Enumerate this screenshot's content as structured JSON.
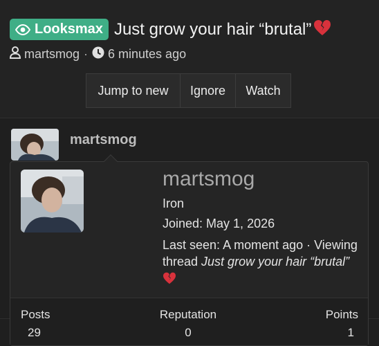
{
  "thread": {
    "prefix": "Looksmax",
    "title": "Just grow your hair “brutal”",
    "author": "martsmog",
    "separator": "·",
    "time": "6 minutes ago"
  },
  "actions": {
    "jump_label": "Jump to new",
    "ignore_label": "Ignore",
    "watch_label": "Watch"
  },
  "post": {
    "username": "martsmog"
  },
  "tooltip": {
    "username": "martsmog",
    "rank": "Iron",
    "joined": "Joined: May 1, 2026",
    "last_seen_prefix": "Last seen: A moment ago · Viewing thread ",
    "viewing_title": "Just grow your hair “brutal”",
    "stats": [
      {
        "label": "Posts",
        "value": "29"
      },
      {
        "label": "Reputation",
        "value": "0"
      },
      {
        "label": "Points",
        "value": "1"
      }
    ]
  },
  "colors": {
    "prefix_bg": "#3fae86",
    "background": "#232323",
    "tooltip_bg": "#252525"
  },
  "icons": {
    "prefix": "eye-icon",
    "author": "user-icon",
    "time": "clock-icon",
    "title_emoji": "broken-heart-icon"
  }
}
